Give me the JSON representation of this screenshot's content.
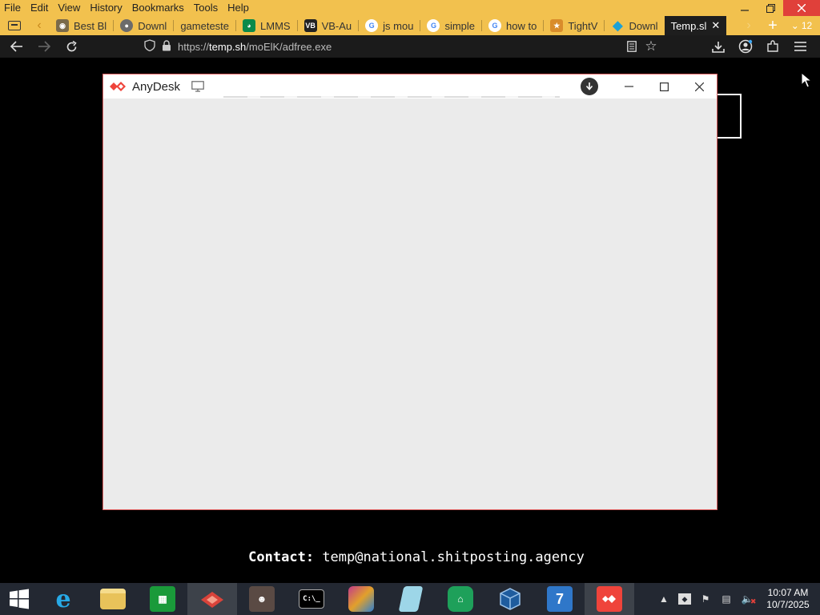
{
  "menu": [
    "File",
    "Edit",
    "View",
    "History",
    "Bookmarks",
    "Tools",
    "Help"
  ],
  "tabs": [
    {
      "label": "Best Bl",
      "icon": "media-icon",
      "color": "#7a6a4a"
    },
    {
      "label": "Downl",
      "icon": "globe-icon",
      "color": "#6b6b6b"
    },
    {
      "label": "gameteste",
      "icon": "",
      "color": ""
    },
    {
      "label": "LMMS",
      "icon": "headphones-icon",
      "color": "#0a8a4a"
    },
    {
      "label": "VB-Au",
      "icon": "vb-icon",
      "color": "#222222"
    },
    {
      "label": "js mou",
      "icon": "google-icon",
      "color": "#ffffff"
    },
    {
      "label": "simple",
      "icon": "google-icon",
      "color": "#ffffff"
    },
    {
      "label": "how to",
      "icon": "google-icon",
      "color": "#ffffff"
    },
    {
      "label": "TightV",
      "icon": "tightvnc-icon",
      "color": "#d98c2b"
    },
    {
      "label": "Downl",
      "icon": "diamond-icon",
      "color": "#1da1d6"
    }
  ],
  "active_tab": {
    "label": "Temp.sl"
  },
  "tab_count": "12",
  "url": {
    "scheme": "https://",
    "host": "temp.sh",
    "path": "/moElK/adfree.exe"
  },
  "anydesk": {
    "title": "AnyDesk",
    "brand_color": "#ef443b"
  },
  "contact": {
    "label": "Contact:",
    "email": "temp@national.shitposting.agency"
  },
  "clock": {
    "time": "10:07 AM",
    "date": "10/7/2025"
  },
  "taskbar_apps": [
    "internet-explorer-icon",
    "file-explorer-icon",
    "store-icon",
    "red-app-icon",
    "person-app-icon",
    "cmd-icon",
    "winrar-icon",
    "notepad-icon",
    "sheep-icon",
    "virtualbox-icon",
    "seven-icon",
    "anydesk-icon"
  ]
}
